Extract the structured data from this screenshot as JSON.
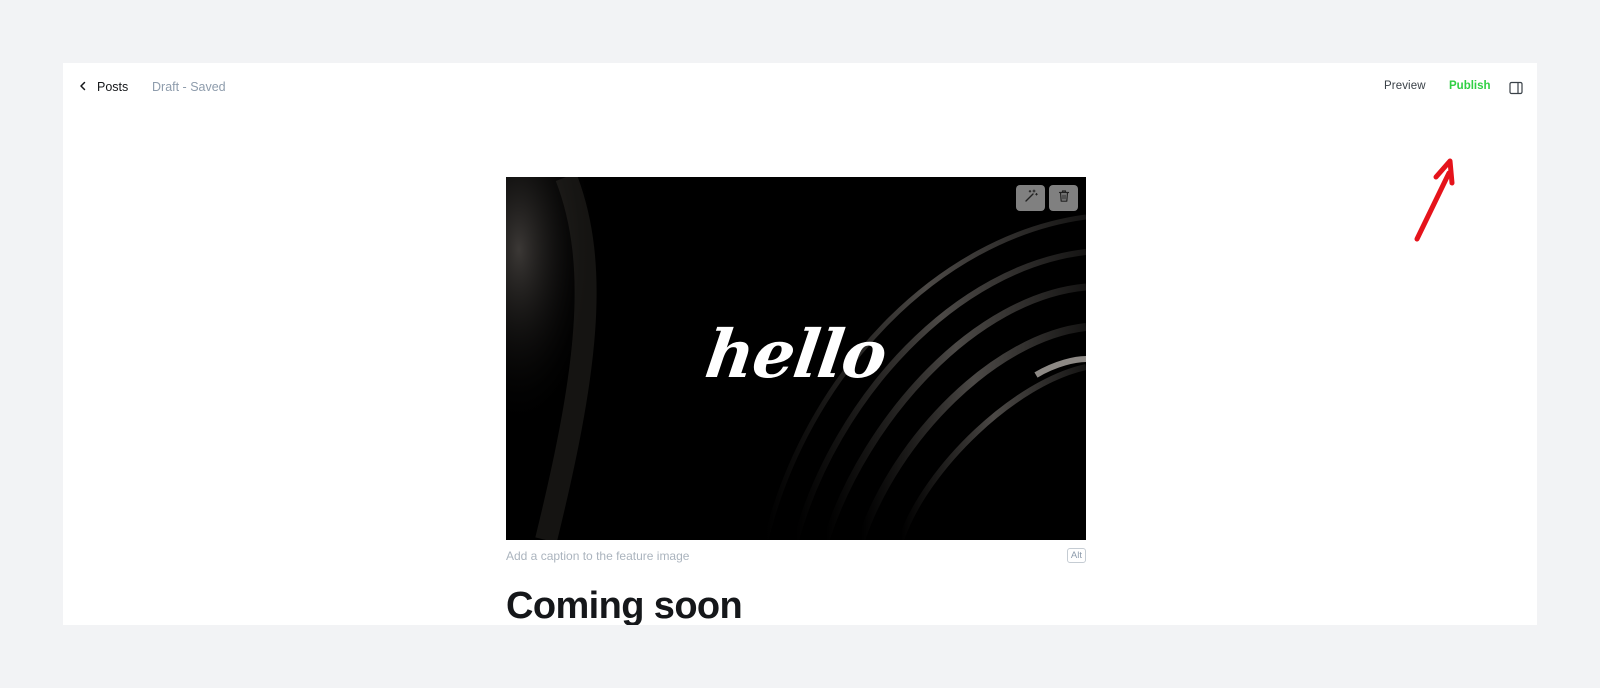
{
  "header": {
    "back_label": "Posts",
    "status": "Draft - Saved",
    "preview_label": "Preview",
    "publish_label": "Publish"
  },
  "feature_image": {
    "image_text": "hello",
    "caption_placeholder": "Add a caption to the feature image",
    "alt_label": "Alt"
  },
  "post": {
    "title": "Coming soon"
  },
  "colors": {
    "publish": "#30cf43",
    "annotation_arrow": "#e5131b",
    "background": "#f2f3f5"
  },
  "icons": {
    "back": "chevron-left-icon",
    "sidebar": "sidebar-toggle-icon",
    "unsplash": "magic-wand-icon",
    "delete": "trash-icon"
  }
}
